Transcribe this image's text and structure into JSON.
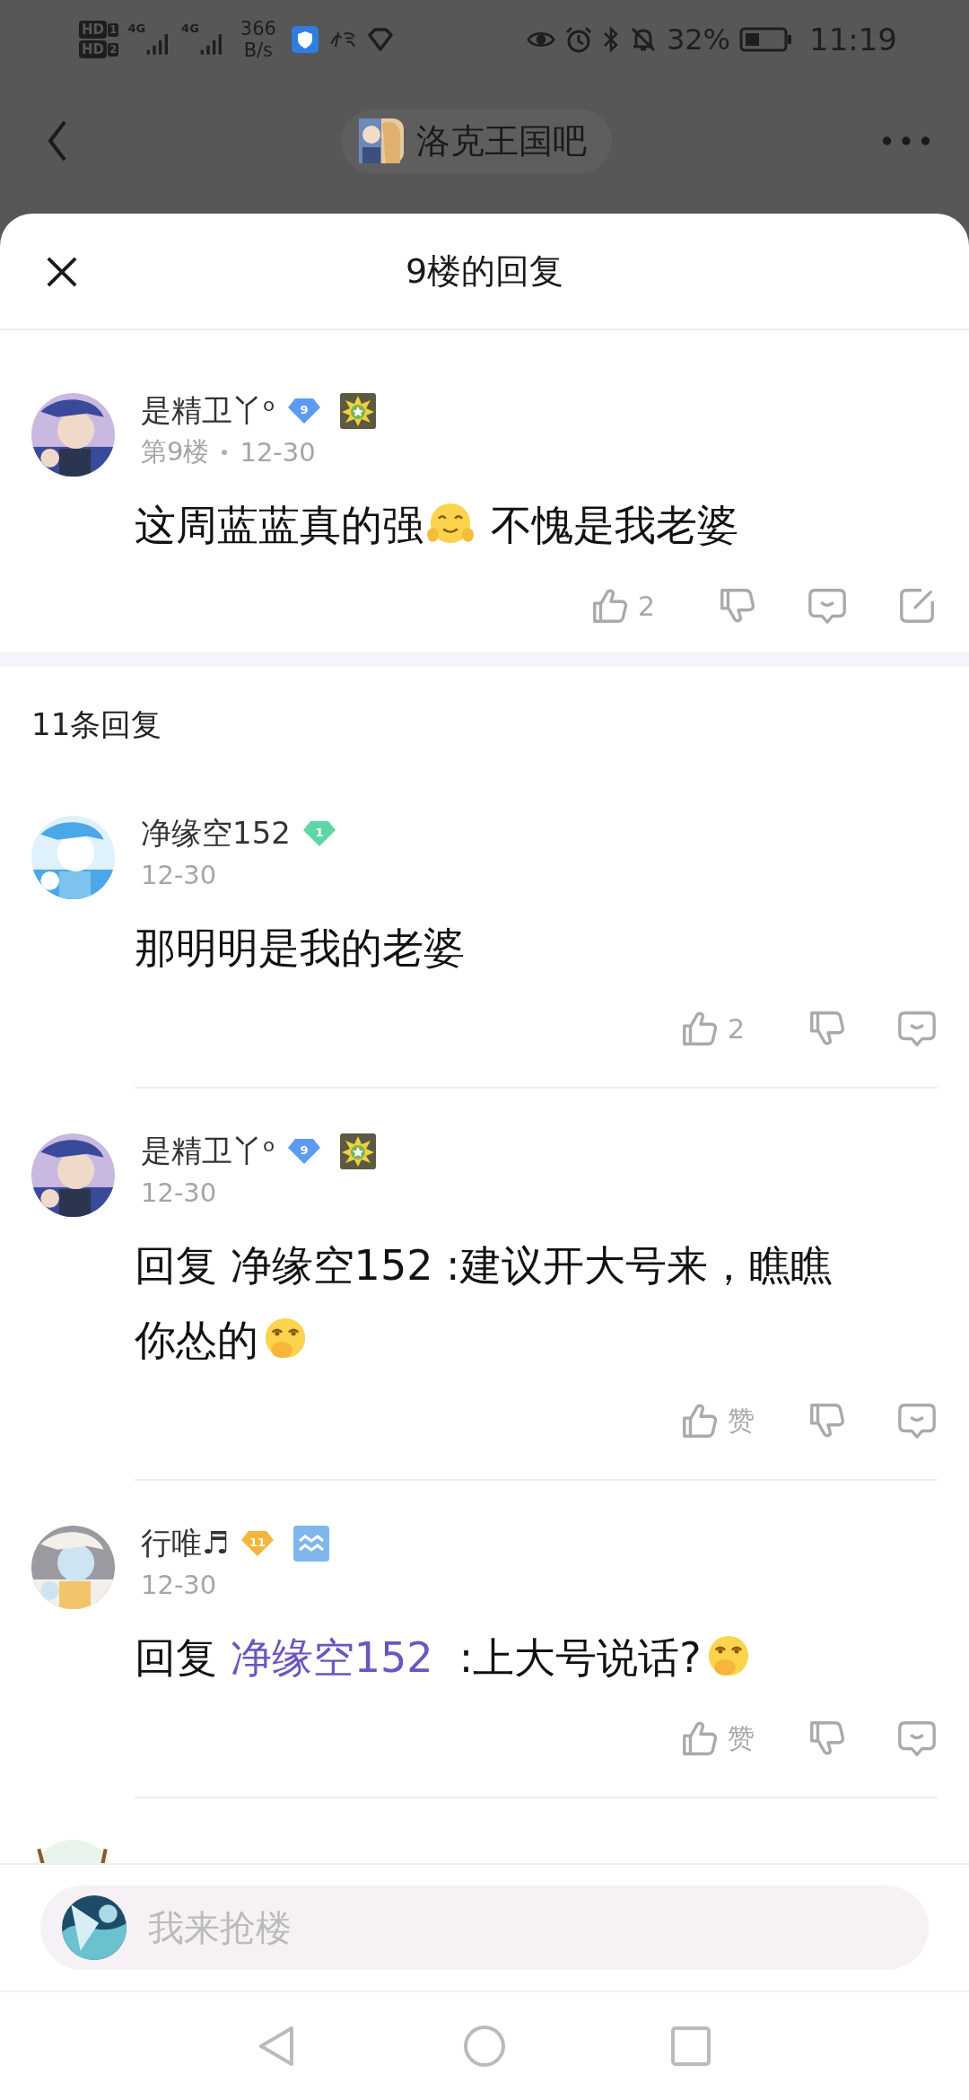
{
  "status_bar": {
    "sims": [
      {
        "label": "HD",
        "slot": "1",
        "network": "4G"
      },
      {
        "label": "HD",
        "slot": "2",
        "network": "4G"
      }
    ],
    "speed": "366",
    "speed_unit": "B/s",
    "battery": "32%",
    "time": "11:19"
  },
  "header": {
    "title": "洛克王国吧"
  },
  "sheet": {
    "title": "9楼的回复"
  },
  "post": {
    "name": "是精卫丫ᵒ",
    "badges": [
      {
        "kind": "level",
        "text": "9",
        "color": "#5b9cf2"
      },
      {
        "kind": "medal"
      }
    ],
    "floor": "第9楼",
    "date": "12-30",
    "content": [
      {
        "kind": "text",
        "text": "这周蓝蓝真的强"
      },
      {
        "kind": "hug-emoji"
      },
      {
        "kind": "text",
        "text": " 不愧是我老婆"
      }
    ],
    "like_label": "2",
    "share": true
  },
  "reply_count": "11条回复",
  "replies": [
    {
      "name": "净缘空152",
      "badges": [
        {
          "kind": "level",
          "text": "1",
          "color": "#5fd6a6"
        }
      ],
      "date": "12-30",
      "content": [
        {
          "kind": "text",
          "text": "那明明是我的老婆"
        }
      ],
      "like_label": "2",
      "share": false
    },
    {
      "name": "是精卫丫ᵒ",
      "badges": [
        {
          "kind": "level",
          "text": "9",
          "color": "#5b9cf2"
        },
        {
          "kind": "medal"
        }
      ],
      "date": "12-30",
      "content": [
        {
          "kind": "text",
          "text": "回复 净缘空152 :建议开大号来，瞧瞧你怂的"
        },
        {
          "kind": "giggle-emoji"
        }
      ],
      "like_label": "赞",
      "share": false
    },
    {
      "name": "行唯♬",
      "badges": [
        {
          "kind": "level",
          "text": "11",
          "color": "#f5b63a"
        },
        {
          "kind": "wave"
        }
      ],
      "date": "12-30",
      "content": [
        {
          "kind": "text",
          "text": "回复 "
        },
        {
          "kind": "link",
          "text": "净缘空152"
        },
        {
          "kind": "text",
          "text": "  :上大号说话?"
        },
        {
          "kind": "giggle-emoji"
        }
      ],
      "like_label": "赞",
      "share": false
    }
  ],
  "next_reply_peek": true,
  "input": {
    "placeholder": "我来抢楼"
  }
}
